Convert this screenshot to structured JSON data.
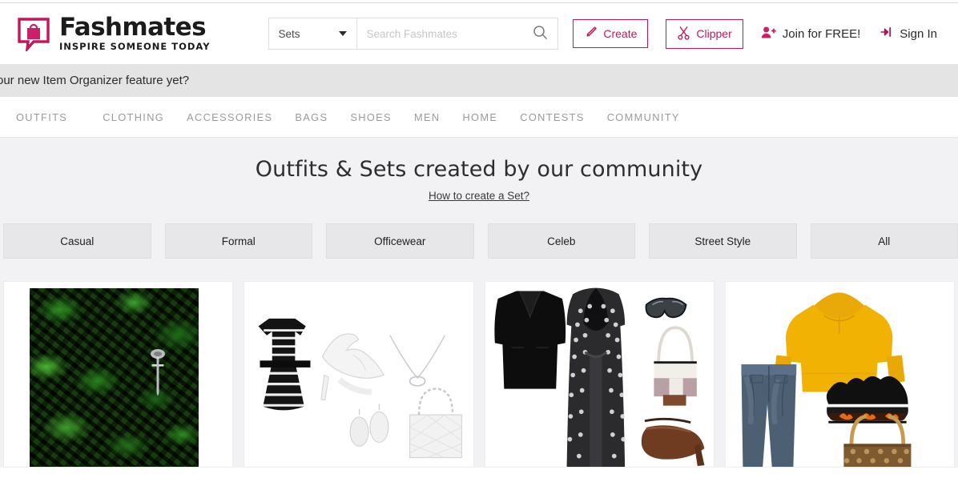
{
  "brand": {
    "name": "Fashmates",
    "tagline": "INSPIRE SOMEONE TODAY",
    "logo_icon": "speech-bubble-shopping-bag-icon",
    "accent_color": "#c2185b"
  },
  "search": {
    "category_value": "Sets",
    "placeholder": "Search Fashmates",
    "value": "",
    "dropdown_icon": "chevron-down-icon",
    "submit_icon": "search-icon"
  },
  "header_actions": {
    "create": {
      "label": "Create",
      "icon": "paintbrush-icon"
    },
    "clipper": {
      "label": "Clipper",
      "icon": "scissors-icon"
    },
    "join": {
      "label": "Join for FREE!",
      "icon": "user-add-icon"
    },
    "signin": {
      "label": "Sign In",
      "icon": "sign-in-arrow-icon"
    }
  },
  "promo": {
    "text": "our new Item Organizer feature yet?"
  },
  "nav": {
    "items": [
      {
        "label": "OUTFITS"
      },
      {
        "label": "CLOTHING"
      },
      {
        "label": "ACCESSORIES"
      },
      {
        "label": "BAGS"
      },
      {
        "label": "SHOES"
      },
      {
        "label": "MEN"
      },
      {
        "label": "HOME"
      },
      {
        "label": "CONTESTS"
      },
      {
        "label": "COMMUNITY"
      }
    ]
  },
  "hero": {
    "title": "Outfits & Sets created by our community",
    "link": "How to create a Set?"
  },
  "filters": {
    "items": [
      {
        "label": "Casual"
      },
      {
        "label": "Formal"
      },
      {
        "label": "Officewear"
      },
      {
        "label": "Celeb"
      },
      {
        "label": "Street Style"
      },
      {
        "label": "All"
      }
    ]
  },
  "cards": [
    {
      "alt": "Dark green abstract foliage set with silver cross pendant"
    },
    {
      "alt": "Black and white striped dress with white heels, necklace, earrings and quilted tote"
    },
    {
      "alt": "Black blazer with patterned maxi dress, sunglasses, handbag and brown heeled sandals"
    },
    {
      "alt": "Yellow hoodie with blue jeans, black flame sneakers and monogram tote bag"
    }
  ]
}
